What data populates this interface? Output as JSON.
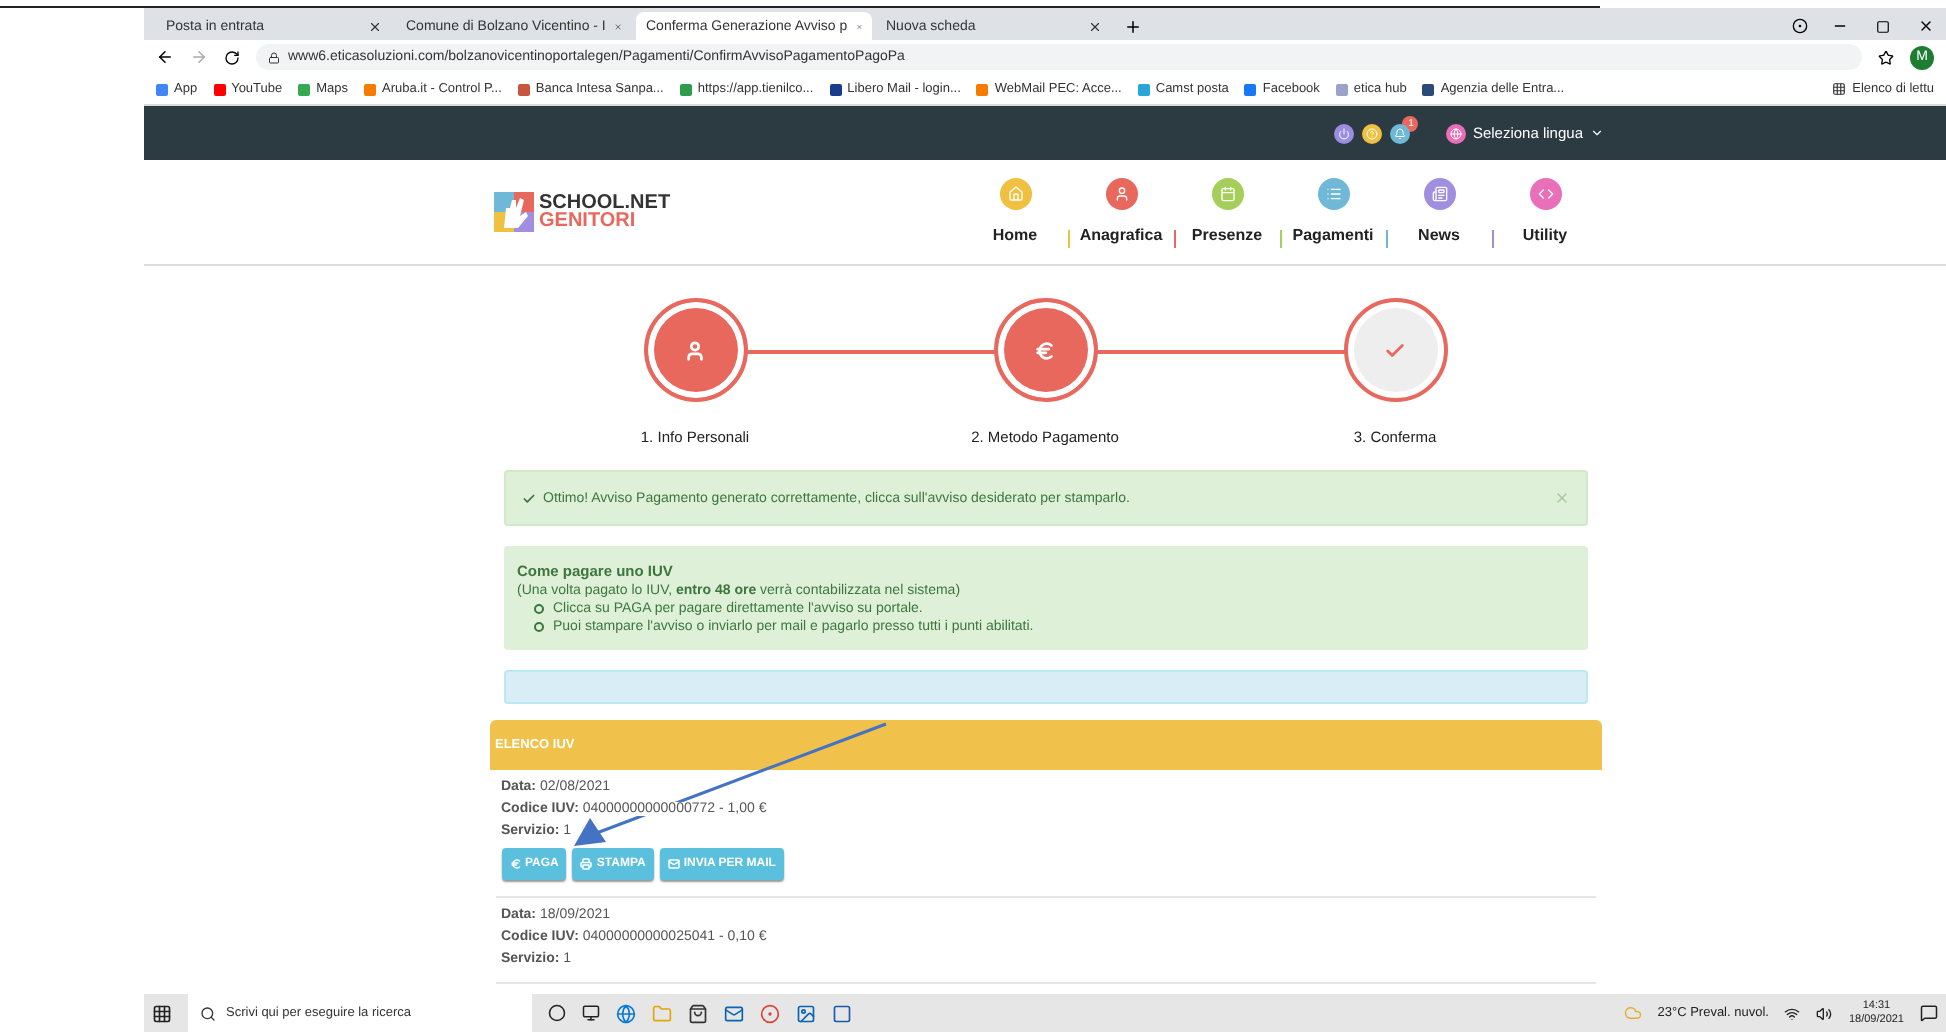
{
  "browser": {
    "tabs": [
      {
        "title": "Posta in entrata",
        "selected": false
      },
      {
        "title": "Comune di Bolzano Vicentino - I",
        "selected": false
      },
      {
        "title": "Conferma Generazione Avviso p",
        "selected": true
      },
      {
        "title": "Nuova scheda",
        "selected": false
      }
    ],
    "url": "www6.eticasoluzioni.com/bolzanovicentinoportalegen/Pagamenti/ConfirmAvvisoPagamentoPagoPa",
    "profile": "M",
    "bookmarks": [
      {
        "label": "App",
        "color": "#4285f4"
      },
      {
        "label": "YouTube",
        "color": "#ff0000"
      },
      {
        "label": "Maps",
        "color": "#34a853"
      },
      {
        "label": "Aruba.it - Control P...",
        "color": "#f57c00"
      },
      {
        "label": "Banca Intesa Sanpa...",
        "color": "#c8553d"
      },
      {
        "label": "https://app.tienilco...",
        "color": "#2e9c4a"
      },
      {
        "label": "Libero Mail - login...",
        "color": "#1a3c8c"
      },
      {
        "label": "WebMail PEC: Acce...",
        "color": "#f57c00"
      },
      {
        "label": "Camst posta",
        "color": "#2aa5d8"
      },
      {
        "label": "Facebook",
        "color": "#1877f2"
      },
      {
        "label": "etica hub",
        "color": "#9aa4c8"
      },
      {
        "label": "Agenzia delle Entra...",
        "color": "#2b4a7a"
      }
    ],
    "reading_list": "Elenco di lettu"
  },
  "topbar": {
    "notifications": "1",
    "language": "Seleziona lingua"
  },
  "logo": {
    "line1": "SCHOOL.NET",
    "line2": "GENITORI"
  },
  "nav": [
    {
      "label": "Home",
      "color": "#f0c040"
    },
    {
      "label": "Anagrafica",
      "color": "#e8685e"
    },
    {
      "label": "Presenze",
      "color": "#a5cf5a"
    },
    {
      "label": "Pagamenti",
      "color": "#6fb8d8"
    },
    {
      "label": "News",
      "color": "#a08ee0"
    },
    {
      "label": "Utility",
      "color": "#e86fb8"
    }
  ],
  "steps": [
    {
      "label": "1. Info Personali",
      "completed": true
    },
    {
      "label": "2. Metodo Pagamento",
      "completed": true
    },
    {
      "label": "3. Conferma",
      "completed": false
    }
  ],
  "success_alert": "Ottimo! Avviso Pagamento generato correttamente, clicca sull'avviso desiderato per stamparlo.",
  "info": {
    "title": "Come pagare uno IUV",
    "subtitle": "(Una volta pagato lo IUV, **entro 48 ore** verrà contabilizzata nel sistema)",
    "bullets": [
      "Clicca su PAGA per pagare direttamente l'avviso su portale.",
      "Puoi stampare l'avviso o inviarlo per mail e pagarlo presso tutti i punti abilitati."
    ]
  },
  "list": {
    "title": "ELENCO IUV",
    "items": [
      {
        "fields": [
          {
            "label": "Data:",
            "value": "02/08/2021"
          },
          {
            "label": "Codice IUV:",
            "value": "04000000000000772 - 1,00 €"
          },
          {
            "label": "Servizio:",
            "value": "1"
          }
        ],
        "buttons": [
          "PAGA",
          "STAMPA",
          "INVIA PER MAIL"
        ]
      },
      {
        "fields": [
          {
            "label": "Data:",
            "value": "18/09/2021"
          },
          {
            "label": "Codice IUV:",
            "value": "04000000000025041 - 0,10 €"
          },
          {
            "label": "Servizio:",
            "value": "1"
          }
        ]
      }
    ]
  },
  "taskbar": {
    "search_placeholder": "Scrivi qui per eseguire la ricerca",
    "weather": "23°C  Preval. nuvol.",
    "time": "14:31",
    "date": "18/09/2021"
  }
}
